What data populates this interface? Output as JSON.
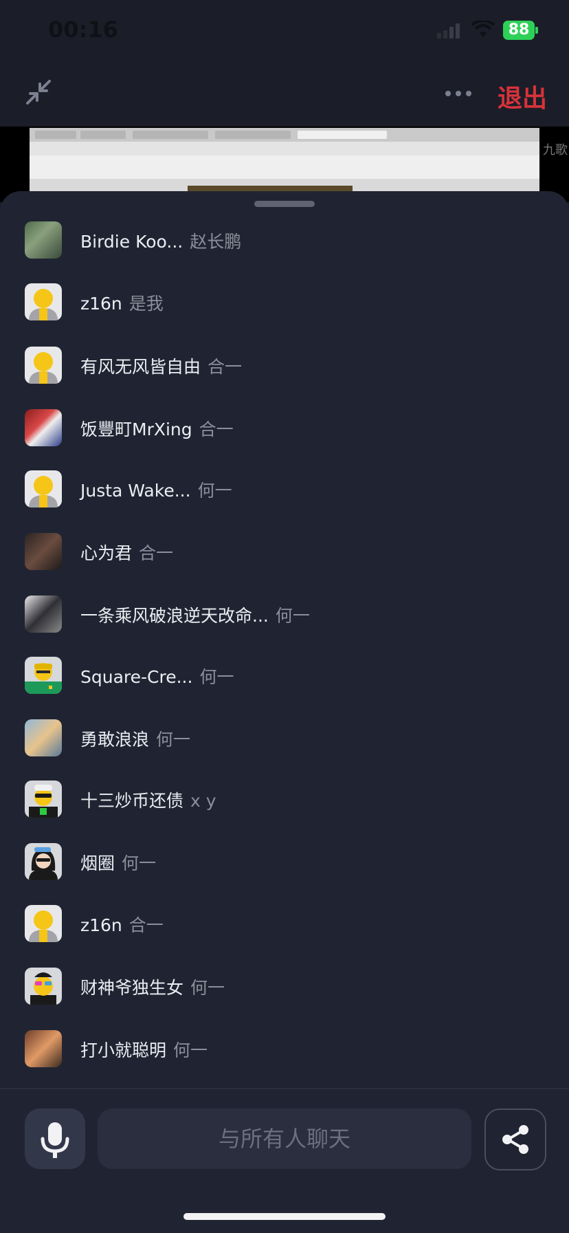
{
  "status_bar": {
    "time": "00:16",
    "battery": "88"
  },
  "top_bar": {
    "exit_label": "退出"
  },
  "screen_share": {
    "side_text": "九歌"
  },
  "members": [
    {
      "name": "Birdie Koo...",
      "role": "赵长鹏",
      "avatar": "photo"
    },
    {
      "name": "z16n",
      "role": "是我",
      "avatar": "yellow-default"
    },
    {
      "name": "有风无风皆自由",
      "role": "合一",
      "avatar": "yellow-default"
    },
    {
      "name": "饭豐町MrXing",
      "role": "合一",
      "avatar": "photo2"
    },
    {
      "name": "Justa Wake...",
      "role": "何一",
      "avatar": "yellow-default"
    },
    {
      "name": "心为君",
      "role": "合一",
      "avatar": "photo3"
    },
    {
      "name": "一条乘风破浪逆天改命...",
      "role": "何一",
      "avatar": "photo4"
    },
    {
      "name": "Square-Cre...",
      "role": "何一",
      "avatar": "green-helmet"
    },
    {
      "name": "勇敢浪浪",
      "role": "何一",
      "avatar": "photo5"
    },
    {
      "name": "十三炒币还债",
      "role": "x y",
      "avatar": "sunglasses-green"
    },
    {
      "name": "烟圈",
      "role": "何一",
      "avatar": "black-hair"
    },
    {
      "name": "z16n",
      "role": "合一",
      "avatar": "yellow-default"
    },
    {
      "name": "财神爷独生女",
      "role": "何一",
      "avatar": "party-glasses"
    },
    {
      "name": "打小就聪明",
      "role": "何一",
      "avatar": "photo6"
    }
  ],
  "chat": {
    "placeholder": "与所有人聊天"
  },
  "icons": {
    "mic": "microphone-icon",
    "share": "share-icon",
    "collapse": "collapse-arrows-icon",
    "more": "more-dots-icon"
  },
  "colors": {
    "exit": "#d8323a",
    "battery": "#2ed158",
    "sheet": "#202432"
  }
}
